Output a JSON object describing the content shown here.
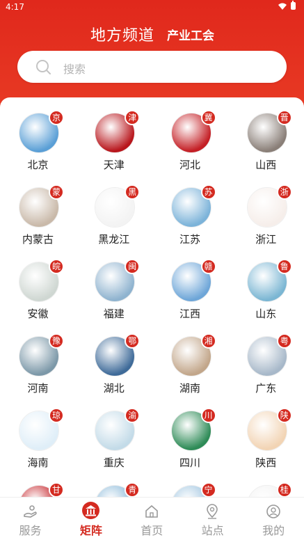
{
  "status": {
    "time": "4:17"
  },
  "header": {
    "title": "地方频道",
    "subtitle": "产业工会"
  },
  "search": {
    "placeholder": "搜索"
  },
  "channels": [
    {
      "name": "北京",
      "badge": "京",
      "bg": "#5a9fd6"
    },
    {
      "name": "天津",
      "badge": "津",
      "bg": "#b8161c"
    },
    {
      "name": "河北",
      "badge": "冀",
      "bg": "#c41f25"
    },
    {
      "name": "山西",
      "badge": "晋",
      "bg": "#8a7f78"
    },
    {
      "name": "内蒙古",
      "badge": "蒙",
      "bg": "#c9b9a9"
    },
    {
      "name": "黑龙江",
      "badge": "黑",
      "bg": "#f3f3f3"
    },
    {
      "name": "江苏",
      "badge": "苏",
      "bg": "#7cb3d9"
    },
    {
      "name": "浙江",
      "badge": "浙",
      "bg": "#f6eeea"
    },
    {
      "name": "安徽",
      "badge": "皖",
      "bg": "#cfd7d2"
    },
    {
      "name": "福建",
      "badge": "闽",
      "bg": "#8fb3cf"
    },
    {
      "name": "江西",
      "badge": "赣",
      "bg": "#6ea6d8"
    },
    {
      "name": "山东",
      "badge": "鲁",
      "bg": "#7bb6d3"
    },
    {
      "name": "河南",
      "badge": "豫",
      "bg": "#7c98a8"
    },
    {
      "name": "湖北",
      "badge": "鄂",
      "bg": "#3f6b99"
    },
    {
      "name": "湖南",
      "badge": "湘",
      "bg": "#c2a68a"
    },
    {
      "name": "广东",
      "badge": "粤",
      "bg": "#a7b8c9"
    },
    {
      "name": "海南",
      "badge": "琼",
      "bg": "#dfeef8"
    },
    {
      "name": "重庆",
      "badge": "渝",
      "bg": "#c3dbe8"
    },
    {
      "name": "四川",
      "badge": "川",
      "bg": "#2e8b57"
    },
    {
      "name": "陕西",
      "badge": "陕",
      "bg": "#f2d4b4"
    },
    {
      "name": "",
      "badge": "甘",
      "bg": "#c41f25"
    },
    {
      "name": "",
      "badge": "青",
      "bg": "#87b7d8"
    },
    {
      "name": "",
      "badge": "宁",
      "bg": "#9cc3df"
    },
    {
      "name": "",
      "badge": "桂",
      "bg": "#f2f2f2"
    }
  ],
  "tabs": [
    {
      "label": "服务",
      "icon": "service-icon",
      "active": false
    },
    {
      "label": "矩阵",
      "icon": "matrix-icon",
      "active": true
    },
    {
      "label": "首页",
      "icon": "home-icon",
      "active": false
    },
    {
      "label": "站点",
      "icon": "location-icon",
      "active": false
    },
    {
      "label": "我的",
      "icon": "profile-icon",
      "active": false
    }
  ],
  "colors": {
    "brand": "#d42a20"
  }
}
